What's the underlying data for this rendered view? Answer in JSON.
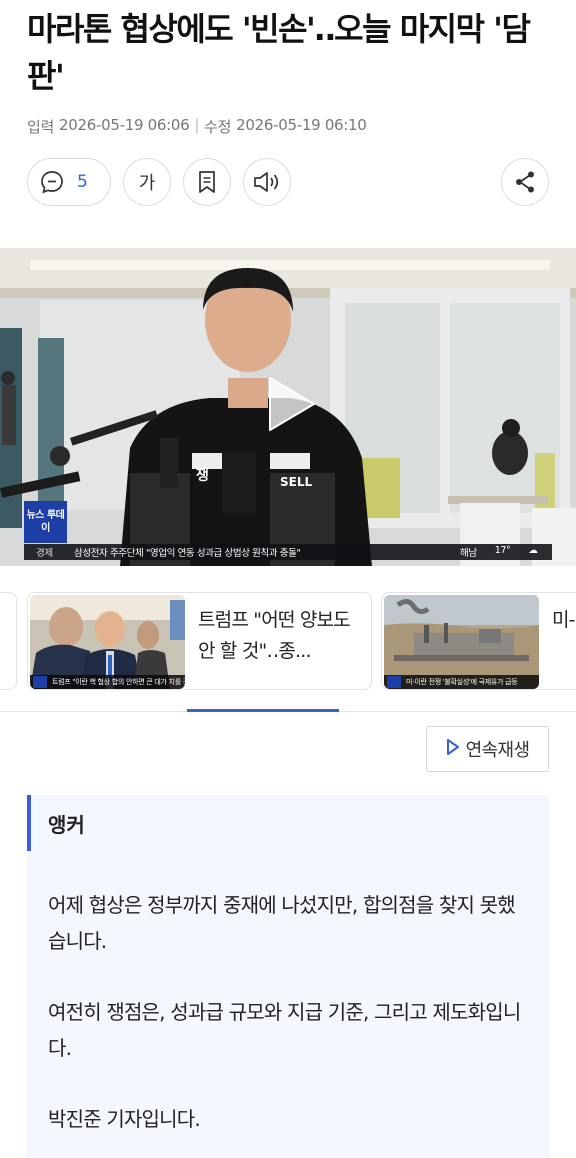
{
  "article": {
    "headline": "마라톤 협상에도 '빈손'‥오늘 마지막 '담판'",
    "published_label": "입력",
    "published": "2026-05-19 06:06",
    "separator": "|",
    "modified_label": "수정",
    "modified": "2026-05-19 06:10"
  },
  "toolbar": {
    "comment_count": "5",
    "font_label": "가",
    "icons": [
      "comment-icon",
      "bookmark-icon",
      "speaker-icon",
      "share-icon"
    ]
  },
  "video": {
    "channel_logo": "뉴스 투데이",
    "ticker_category": "경제",
    "ticker_text": "삼성전자 주주단체 \"영업익 연동 성과급 상법상 원칙과 충돌\"",
    "weather_location": "해남",
    "weather_temp": "17°",
    "vest_text": "쟁",
    "vest_text_2": "SELL",
    "play_icon": "play-icon"
  },
  "related": [
    {
      "title": "트럼프 \"어떤 양보도 안 할 것\"‥종...",
      "caption": "트럼프 \"이란 핵 협상 합의 안하면 큰 대가 치를 것\""
    },
    {
      "title": "미-이란 전쟁 실상",
      "caption": "미-이란 전쟁 '불확실성'에 국제유가 급등"
    }
  ],
  "autoplay": {
    "label": "연속재생",
    "icon": "play-outline-icon"
  },
  "body": {
    "section_label": "앵커",
    "paragraphs": [
      "어제 협상은 정부까지 중재에 나섰지만, 합의점을 찾지 못했습니다.",
      "여전히 쟁점은, 성과급 규모와 지급 기준, 그리고 제도화입니다.",
      "박진준 기자입니다."
    ]
  },
  "colors": {
    "accent": "#3a5fcf",
    "comment_count": "#3464d8",
    "article_bg": "#f4f7fd",
    "logo_blue": "#1f3fa8"
  }
}
